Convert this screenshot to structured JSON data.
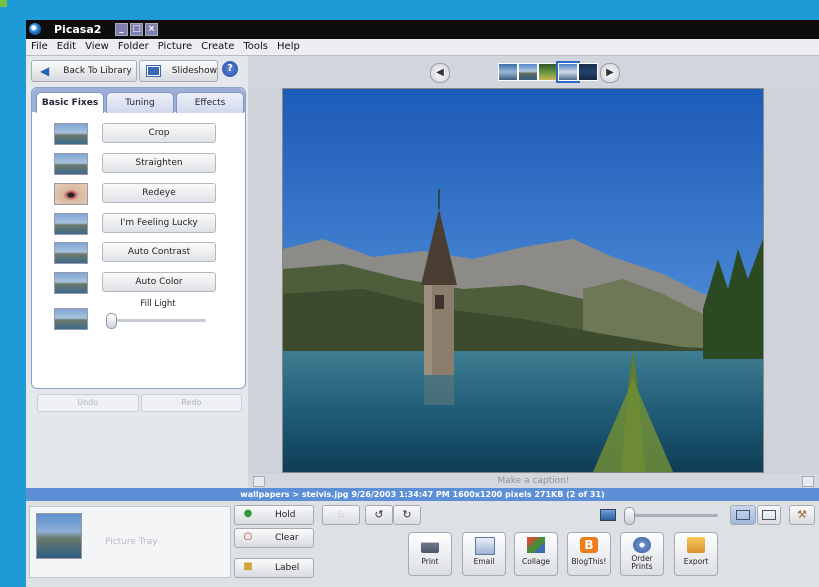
{
  "window": {
    "title": "Picasa2",
    "controls": [
      "_",
      "□",
      "×"
    ]
  },
  "menu": [
    "File",
    "Edit",
    "View",
    "Folder",
    "Picture",
    "Create",
    "Tools",
    "Help"
  ],
  "toolbar": {
    "back_label": "Back To Library",
    "slideshow_label": "Slideshow",
    "help_label": "?"
  },
  "tabs": [
    {
      "label": "Basic Fixes",
      "active": true
    },
    {
      "label": "Tuning",
      "active": false
    },
    {
      "label": "Effects",
      "active": false
    }
  ],
  "fixes": [
    {
      "label": "Crop",
      "icon": "crop-thumb"
    },
    {
      "label": "Straighten",
      "icon": "straighten-thumb"
    },
    {
      "label": "Redeye",
      "icon": "redeye-thumb"
    },
    {
      "label": "I'm Feeling Lucky",
      "icon": "lucky-thumb"
    },
    {
      "label": "Auto Contrast",
      "icon": "contrast-thumb"
    },
    {
      "label": "Auto Color",
      "icon": "color-thumb"
    }
  ],
  "fill_light": {
    "label": "Fill Light",
    "value": 0
  },
  "history": {
    "undo_label": "Undo",
    "redo_label": "Redo"
  },
  "filmstrip": {
    "thumb_count": 5,
    "active_index": 3
  },
  "caption": {
    "placeholder": "Make a caption!"
  },
  "status": {
    "text": "wallpapers > steivis.jpg    9/26/2003 1:34:47 PM    1600x1200 pixels    271KB    (2 of 31)"
  },
  "tray": {
    "label": "Picture Tray"
  },
  "tray_actions": [
    {
      "label": "Hold",
      "icon": "hold-icon",
      "color": "#2e9a3a"
    },
    {
      "label": "Clear",
      "icon": "clear-icon",
      "color": "#cc2b2b"
    },
    {
      "label": "Label",
      "icon": "label-icon",
      "color": "#d8a23a"
    }
  ],
  "share_actions": [
    {
      "label": "Print",
      "icon": "printer-icon"
    },
    {
      "label": "Email",
      "icon": "email-icon"
    },
    {
      "label": "Collage",
      "icon": "collage-icon"
    },
    {
      "label": "BlogThis!",
      "icon": "blogger-icon"
    },
    {
      "label": "Order Prints",
      "icon": "order-prints-icon"
    },
    {
      "label": "Export",
      "icon": "export-icon"
    }
  ],
  "colors": {
    "accent": "#1e9ad6",
    "statusbar": "#5c8fd6",
    "titlebar": "#0d0d0d"
  }
}
